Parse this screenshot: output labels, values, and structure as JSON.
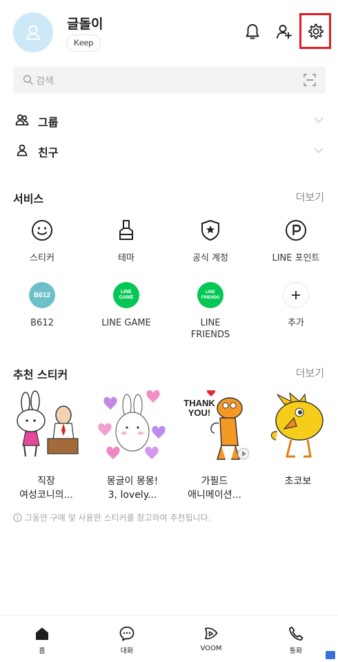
{
  "profile": {
    "name": "글돌이",
    "badge": "Keep"
  },
  "header_icons": [
    "bell-icon",
    "add-friend-icon",
    "gear-icon"
  ],
  "search": {
    "placeholder": "검색"
  },
  "friends_sections": [
    {
      "label": "그룹",
      "icon": "group-icon"
    },
    {
      "label": "친구",
      "icon": "person-icon"
    }
  ],
  "services": {
    "title": "서비스",
    "more": "더보기",
    "items": [
      {
        "label": "스티커",
        "icon": "smiley-icon"
      },
      {
        "label": "테마",
        "icon": "brush-icon"
      },
      {
        "label": "공식 계정",
        "icon": "official-shield-icon"
      },
      {
        "label": "LINE 포인트",
        "icon": "points-icon"
      },
      {
        "label": "B612",
        "icon": "b612-logo",
        "logo_text": "B612",
        "color": "#6dc0c7"
      },
      {
        "label": "LINE GAME",
        "icon": "line-game-logo",
        "logo_text": "LINE GAME",
        "color": "#06c755"
      },
      {
        "label": "LINE FRIENDS",
        "icon": "line-friends-logo",
        "logo_text": "LINE FRIENDS",
        "color": "#06c755"
      },
      {
        "label": "추가",
        "icon": "plus-icon"
      }
    ]
  },
  "stickers": {
    "title": "추천 스티커",
    "more": "더보기",
    "items": [
      {
        "title_line1": "직장",
        "title_line2": "여성코니의..."
      },
      {
        "title_line1": "몽글이 몽몽!",
        "title_line2": "3, lovely..."
      },
      {
        "title_line1": "가필드",
        "title_line2": "애니메이션...",
        "art_text": "THANK YOU!"
      },
      {
        "title_line1": "초코보",
        "title_line2": ""
      }
    ],
    "notice": "그동안 구매 및 사용한 스티커를 참고하여 추천됩니다."
  },
  "bottom_nav": [
    {
      "label": "홈",
      "icon": "home-icon"
    },
    {
      "label": "대화",
      "icon": "chat-icon"
    },
    {
      "label": "VOOM",
      "icon": "voom-icon"
    },
    {
      "label": "통화",
      "icon": "phone-icon"
    }
  ],
  "colors": {
    "accent": "#06c755",
    "highlight": "#e21b23",
    "text": "#1e1e1e",
    "muted": "#8b8b8e"
  }
}
